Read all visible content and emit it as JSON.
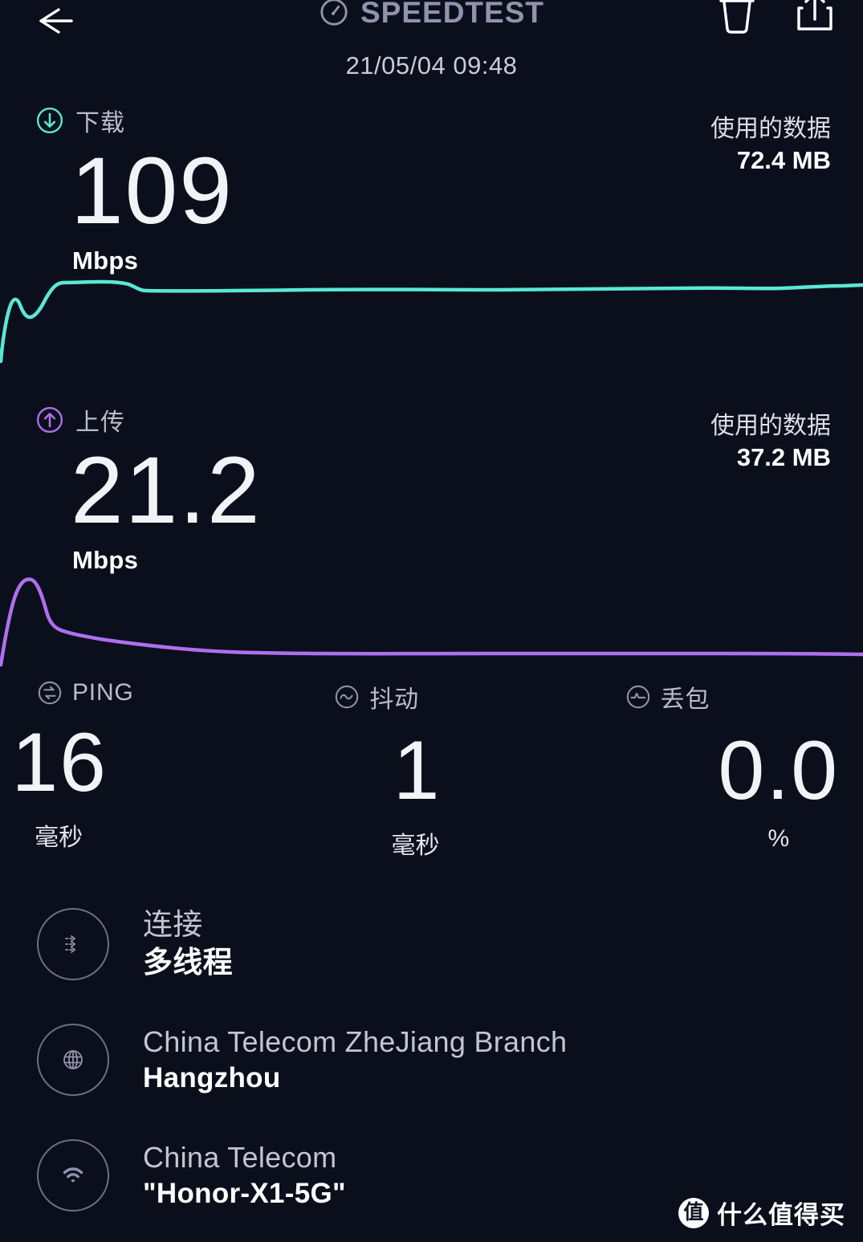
{
  "theme": {
    "background": "#0b0f1c",
    "download_accent": "#5ae8d6",
    "upload_accent": "#b06ef0",
    "muted_text": "#8f93ab",
    "primary_text": "#ffffff"
  },
  "header": {
    "back_icon": "back-arrow-icon",
    "logo_icon": "speedometer-icon",
    "title": "SPEEDTEST",
    "trash_icon": "trash-icon",
    "share_icon": "share-icon",
    "date": "21/05/04 09:48"
  },
  "download": {
    "icon": "download-arrow-circle-icon",
    "label": "下载",
    "value": "109",
    "unit": "Mbps",
    "data_used_label": "使用的数据",
    "data_used_value": "72.4 MB"
  },
  "upload": {
    "icon": "upload-arrow-circle-icon",
    "label": "上传",
    "value": "21.2",
    "unit": "Mbps",
    "data_used_label": "使用的数据",
    "data_used_value": "37.2 MB"
  },
  "stats": [
    {
      "icon": "ping-icon",
      "label": "PING",
      "value": "16",
      "unit": "毫秒"
    },
    {
      "icon": "jitter-icon",
      "label": "抖动",
      "value": "1",
      "unit": "毫秒"
    },
    {
      "icon": "loss-icon",
      "label": "丢包",
      "value": "0.0",
      "unit": "%"
    }
  ],
  "info_rows": [
    {
      "icon": "connections-icon",
      "primary": "连接",
      "secondary": "多线程"
    },
    {
      "icon": "globe-icon",
      "primary": "China Telecom ZheJiang Branch",
      "secondary": "Hangzhou"
    },
    {
      "icon": "wifi-icon",
      "primary": "China Telecom",
      "secondary": "\"Honor-X1-5G\""
    }
  ],
  "watermark": {
    "badge": "值",
    "text": "什么值得买"
  },
  "chart_data": [
    {
      "type": "line",
      "title": "Download throughput over test duration",
      "series": [
        {
          "name": "下载",
          "color": "#5ae8d6"
        }
      ],
      "unit": "Mbps",
      "final_value": 109,
      "points": [
        [
          0,
          0.05
        ],
        [
          2,
          0.35
        ],
        [
          22,
          0.72
        ],
        [
          31,
          0.62
        ],
        [
          40,
          0.58
        ],
        [
          55,
          0.72
        ],
        [
          70,
          0.92
        ],
        [
          78,
          0.96
        ],
        [
          110,
          0.97
        ],
        [
          140,
          0.96
        ],
        [
          160,
          0.9
        ],
        [
          200,
          0.9
        ],
        [
          260,
          0.92
        ],
        [
          330,
          0.9
        ],
        [
          420,
          0.9
        ],
        [
          520,
          0.91
        ],
        [
          640,
          0.9
        ],
        [
          760,
          0.91
        ],
        [
          860,
          0.9
        ],
        [
          940,
          0.92
        ],
        [
          1000,
          0.9
        ],
        [
          1040,
          0.92
        ],
        [
          1075,
          0.93
        ]
      ],
      "grid": false,
      "legend": "none"
    },
    {
      "type": "line",
      "title": "Upload throughput over test duration",
      "series": [
        {
          "name": "上传",
          "color": "#b06ef0"
        }
      ],
      "unit": "Mbps",
      "final_value": 21.2,
      "points": [
        [
          0,
          0.04
        ],
        [
          8,
          0.35
        ],
        [
          22,
          0.8
        ],
        [
          38,
          1.0
        ],
        [
          50,
          0.82
        ],
        [
          62,
          0.44
        ],
        [
          80,
          0.33
        ],
        [
          110,
          0.27
        ],
        [
          140,
          0.23
        ],
        [
          170,
          0.2
        ],
        [
          230,
          0.15
        ],
        [
          300,
          0.12
        ],
        [
          400,
          0.1
        ],
        [
          520,
          0.09
        ],
        [
          660,
          0.08
        ],
        [
          800,
          0.08
        ],
        [
          940,
          0.07
        ],
        [
          1075,
          0.07
        ]
      ],
      "grid": false,
      "legend": "none"
    }
  ]
}
